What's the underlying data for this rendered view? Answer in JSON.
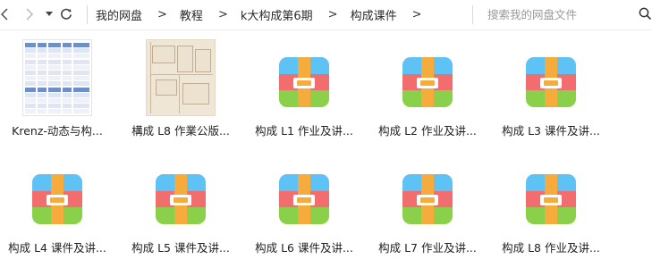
{
  "breadcrumb": [
    "我的网盘",
    "教程",
    "k大构成第6期",
    "构成课件"
  ],
  "search": {
    "placeholder": "搜索我的网盘文件"
  },
  "colors": {
    "zip_blue": "#5ec2f5",
    "zip_red": "#f26d6d",
    "zip_green": "#8ad04a",
    "zip_strap": "#f5ac3c",
    "zip_buckle_inner": "#f5ac3c",
    "accent_blue": "#6f8fc7"
  },
  "files": [
    {
      "name": "Krenz-动态与构...",
      "type": "spreadsheet"
    },
    {
      "name": "構成 L8 作業公版...",
      "type": "floorplan"
    },
    {
      "name": "构成 L1 作业及讲...",
      "type": "archive"
    },
    {
      "name": "构成 L2 作业及讲...",
      "type": "archive"
    },
    {
      "name": "构成 L3 课件及讲...",
      "type": "archive"
    },
    {
      "name": "构成 L4 课件及讲...",
      "type": "archive"
    },
    {
      "name": "构成 L5 课件及讲...",
      "type": "archive"
    },
    {
      "name": "构成 L6 课件及讲...",
      "type": "archive"
    },
    {
      "name": "构成 L7 作业及讲...",
      "type": "archive"
    },
    {
      "name": "构成 L8 作业及讲...",
      "type": "archive"
    }
  ]
}
